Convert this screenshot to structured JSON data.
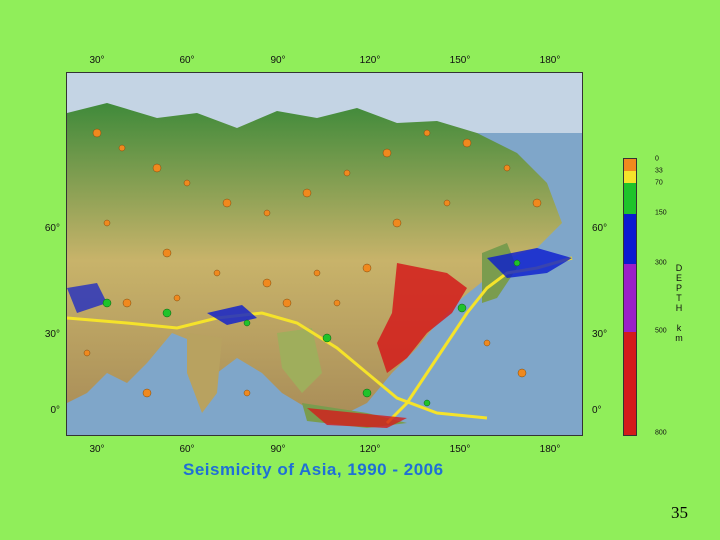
{
  "map": {
    "title": "Seismicity of Asia, 1990 - 2006",
    "lon_labels_top": [
      "30°",
      "60°",
      "90°",
      "120°",
      "150°",
      "180°"
    ],
    "lon_labels_bottom": [
      "30°",
      "60°",
      "90°",
      "120°",
      "150°",
      "180°"
    ],
    "lat_labels_left": [
      "60°",
      "30°",
      "0°"
    ],
    "lat_labels_right": [
      "60°",
      "30°",
      "0°"
    ]
  },
  "legend": {
    "title": "DEPTH km",
    "tick_labels": [
      "0",
      "33",
      "70",
      "150",
      "300",
      "500",
      "800"
    ],
    "colors": [
      "#f0891e",
      "#f5e32a",
      "#1fc32a",
      "#0a1bd0",
      "#9a1fc9",
      "#d41b1b"
    ]
  },
  "page": {
    "number": "35"
  }
}
